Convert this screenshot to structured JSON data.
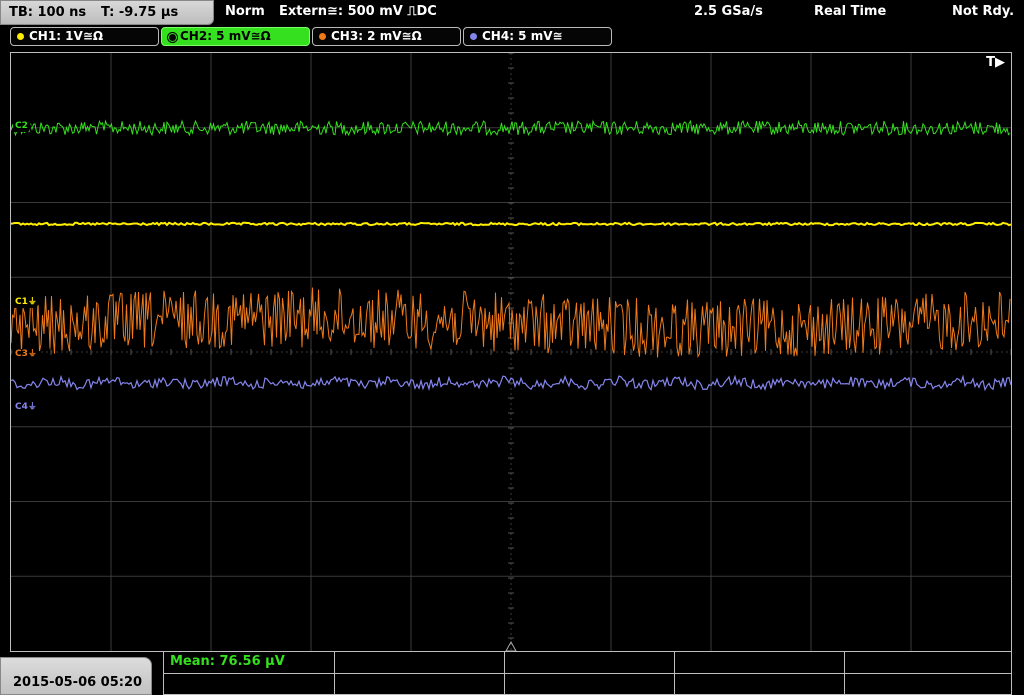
{
  "topbar": {
    "timebase": "TB: 100 ns",
    "trigger_time": "T: -9.75 µs",
    "trigger_mode": "Norm",
    "trigger_source": "Extern≅: 500 mV ⎍DC",
    "sample_rate": "2.5 GSa/s",
    "acq_mode": "Real Time",
    "status": "Not Rdy."
  },
  "channels": [
    {
      "label": "CH1: 1V≅Ω",
      "color": "#ffee00",
      "active": false
    },
    {
      "label": "CH2: 5 mV≅Ω",
      "color": "#35e01e",
      "active": true
    },
    {
      "label": "CH3: 2 mV≅Ω",
      "color": "#f07a1a",
      "active": false
    },
    {
      "label": "CH4: 5 mV≅",
      "color": "#8585ee",
      "active": false
    }
  ],
  "screen": {
    "trigger_indicator": "T▶",
    "markers": [
      {
        "text": "C1⏚",
        "color": "#ffee00",
        "border": "#ffee00"
      },
      {
        "text": "C2",
        "color": "#35e01e",
        "border": "#35e01e"
      },
      {
        "text": "C3⏚",
        "color": "#f07a1a",
        "border": "#f07a1a"
      },
      {
        "text": "C4⏚",
        "color": "#8585ee",
        "border": "#8585ee"
      }
    ],
    "grid_color": "#3a3a3a"
  },
  "bottombar": {
    "datetime": "2015-05-06 05:20",
    "measurement": "Mean: 76.56 µV"
  }
}
